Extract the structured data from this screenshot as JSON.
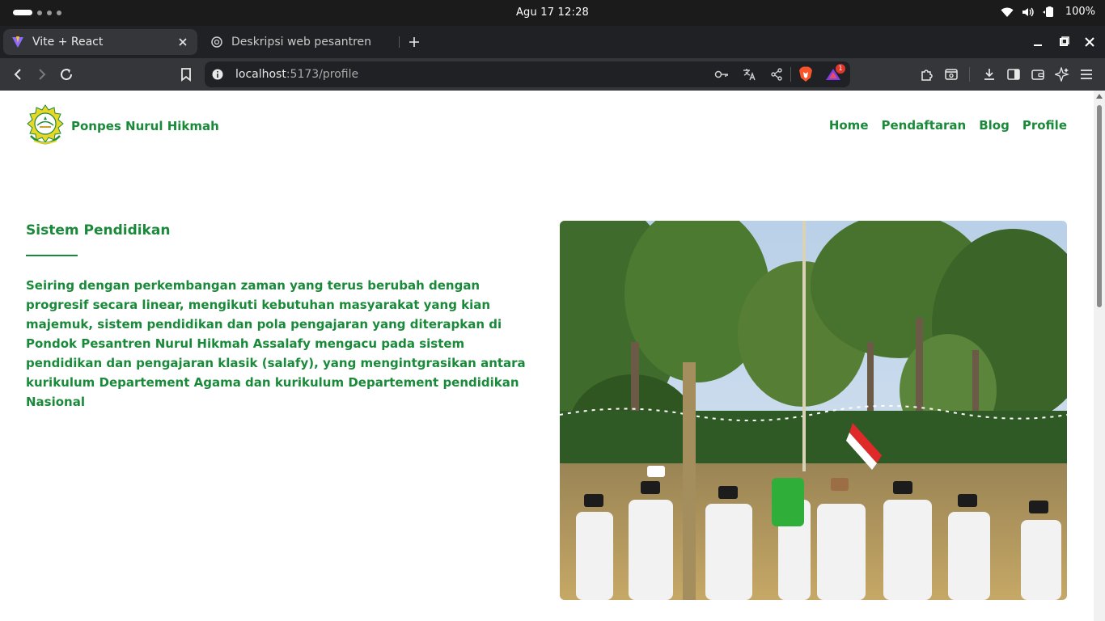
{
  "os": {
    "clock": "Agu 17  12:28",
    "battery": "100%"
  },
  "browser": {
    "tabs": [
      {
        "label": "Vite + React",
        "active": true
      },
      {
        "label": "Deskripsi web pesantren",
        "active": false
      }
    ],
    "address": {
      "host": "localhost",
      "path": ":5173/profile"
    },
    "notification_count": "1"
  },
  "site": {
    "brand": "Ponpes Nurul Hikmah",
    "nav": [
      "Home",
      "Pendaftaran",
      "Blog",
      "Profile"
    ]
  },
  "section": {
    "title": "Sistem Pendidikan",
    "body": "Seiring dengan perkembangan zaman yang terus berubah dengan progresif secara linear, mengikuti kebutuhan masyarakat yang kian majemuk, sistem pendidikan dan pola pengajaran yang diterapkan di Pondok Pesantren Nurul Hikmah Assalafy mengacu pada sistem pendidikan dan pengajaran klasik (salafy), yang mengintgrasikan antara kurikulum Departement Agama dan kurikulum Departement pendidikan Nasional"
  },
  "colors": {
    "brand_green": "#1a8a3a",
    "os_bar": "#1b1b1b",
    "tab_strip": "#202124",
    "toolbar": "#35363a"
  }
}
